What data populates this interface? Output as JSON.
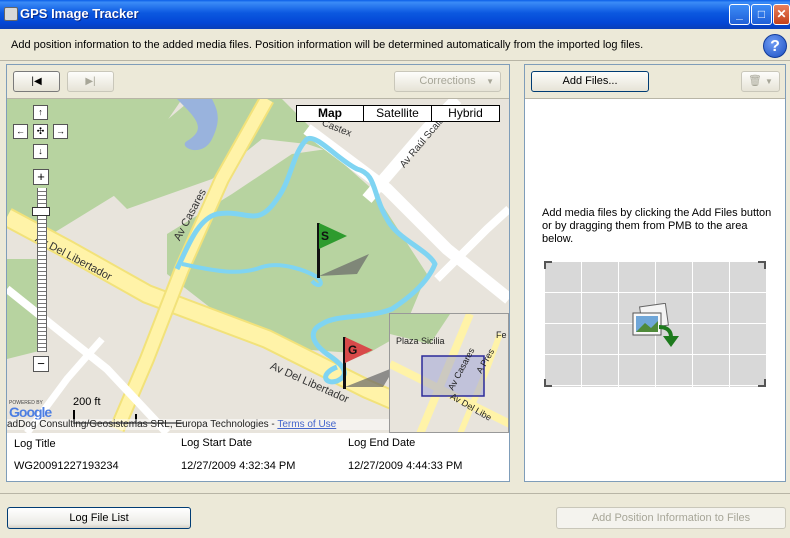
{
  "window": {
    "title": "GPS Image Tracker",
    "minimize_glyph": "_",
    "maximize_glyph": "□",
    "close_glyph": "✕"
  },
  "description": "Add position information to the added media files. Position information will be determined automatically from the imported log files.",
  "help": {
    "label": "?"
  },
  "left_toolbar": {
    "first_glyph": "|◀",
    "next_glyph": "▶|",
    "corrections_label": "Corrections",
    "corrections_arrow": "▼"
  },
  "map": {
    "type_buttons": [
      "Map",
      "Satellite",
      "Hybrid"
    ],
    "selected_type": "Map",
    "streets": {
      "castex": "Castex",
      "raul_scalabrini": "Av Raúl Scalab",
      "casares": "Av Casares",
      "del_libertador_1": "Av Del Libertador",
      "del_libertador_2": "Av Del Libertador"
    },
    "flags": {
      "start": "S",
      "goal": "G"
    },
    "scale_label": "200 ft",
    "powered_by": "POWERED BY",
    "google": "Google",
    "attribution": "adDog Consulting/Geosistemas SRL, Europa Technologies - ",
    "terms": "Terms of Use",
    "overview": {
      "plaza": "Plaza Sicilia",
      "casares": "Av Casares",
      "presidente": "A Pres",
      "libertador": "Av Del Libe",
      "fe": "Fe"
    }
  },
  "log_table": {
    "headers": {
      "title": "Log Title",
      "start": "Log Start Date",
      "end": "Log End Date"
    },
    "rows": [
      {
        "title": "WG20091227193234",
        "start": "12/27/2009 4:32:34 PM",
        "end": "12/27/2009 4:44:33 PM"
      }
    ]
  },
  "right_toolbar": {
    "add_files_label": "Add Files...",
    "trash_glyph": "🗑",
    "trash_arrow": "▼"
  },
  "instructions": "Add media files by clicking the Add Files button or by dragging them from PMB to the area below.",
  "bottom": {
    "log_file_list_label": "Log File List",
    "add_position_label": "Add Position Information to Files"
  },
  "colors": {
    "title_bar": "#0b58e0",
    "park": "#b7d3a0",
    "street": "#fff3a8",
    "track": "#7fd4f2",
    "flag_start": "#2e9b2e",
    "flag_goal": "#d84a4a"
  }
}
